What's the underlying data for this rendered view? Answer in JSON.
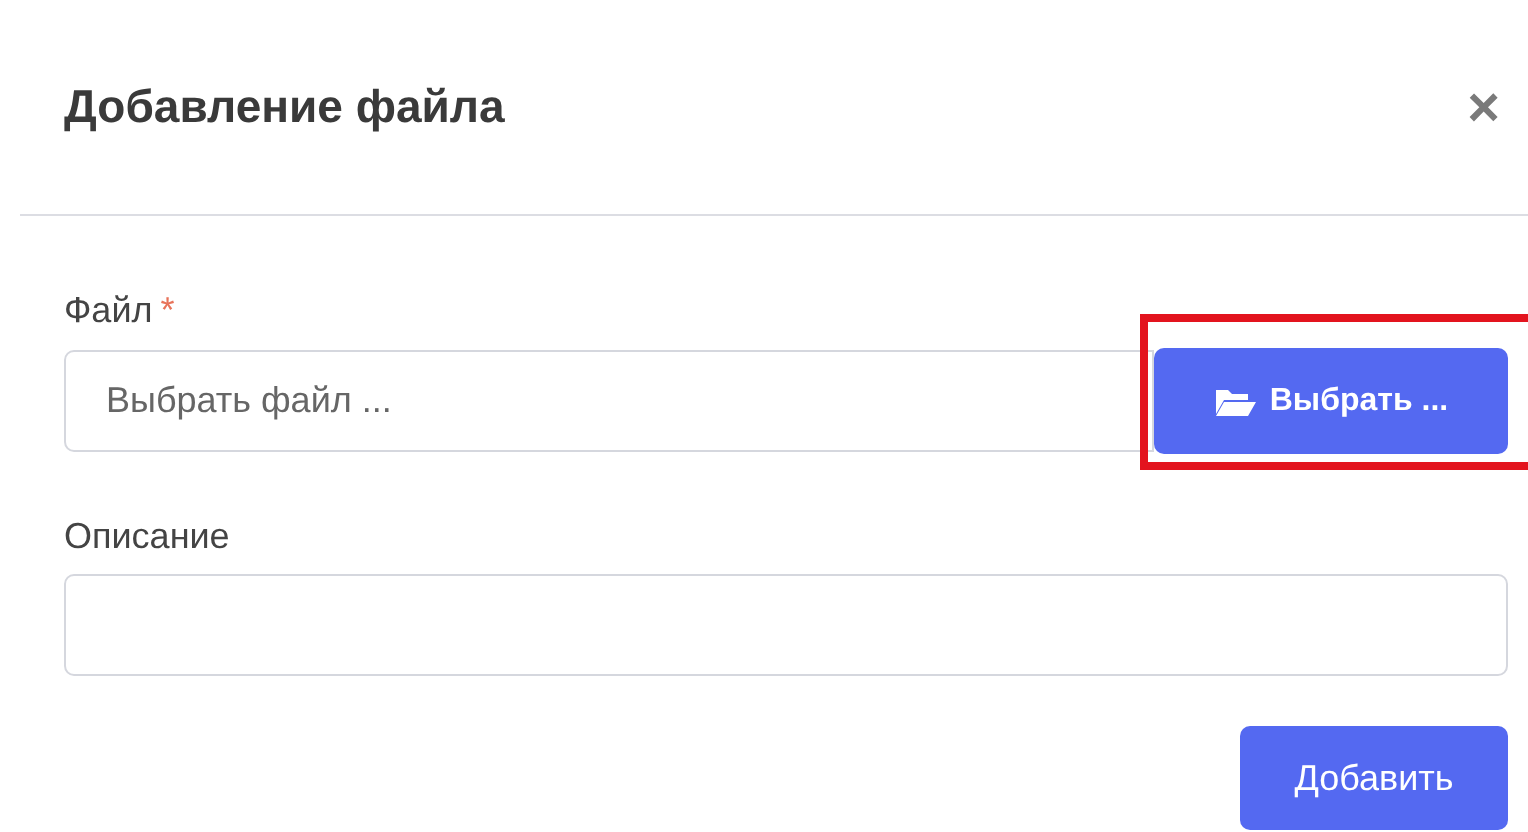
{
  "dialog": {
    "title": "Добавление файла",
    "close": "×"
  },
  "fields": [
    {
      "label": "Файл",
      "required": true,
      "required_mark": "*",
      "placeholder": "Выбрать файл ...",
      "button": {
        "label": "Выбрать ...",
        "highlighted": true
      }
    },
    {
      "label": "Описание",
      "required": false
    }
  ],
  "buttons": [
    "Добавить"
  ]
}
